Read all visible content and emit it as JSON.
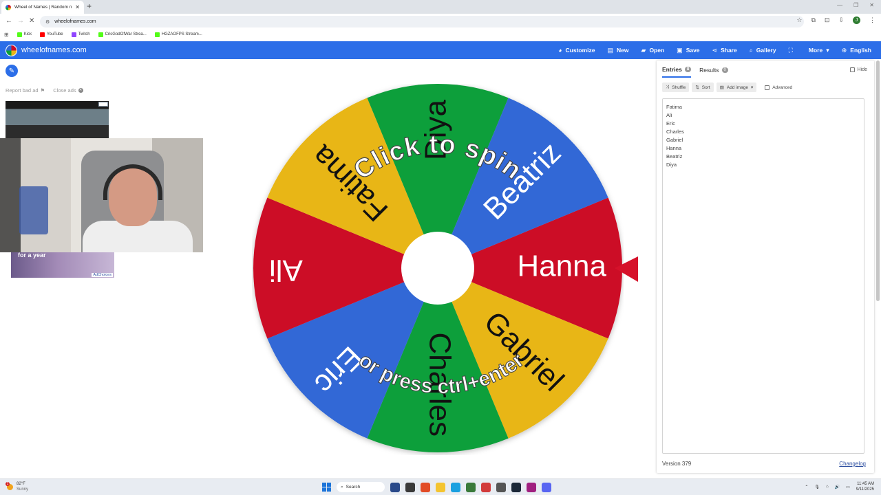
{
  "browser": {
    "tab_title": "Wheel of Names | Random nam",
    "tab_close": "✕",
    "new_tab": "+",
    "url": "wheelofnames.com",
    "bookmarks": [
      {
        "label": "Kick",
        "color": "#53fc18"
      },
      {
        "label": "YouTube",
        "color": "#ff0000"
      },
      {
        "label": "Twitch",
        "color": "#9146ff"
      },
      {
        "label": "CrisGodOfWar Strea...",
        "color": "#53fc18"
      },
      {
        "label": "HGZAOFPS Stream...",
        "color": "#53fc18"
      }
    ],
    "profile_initial": "J"
  },
  "app": {
    "brand": "wheelofnames.com",
    "menu": [
      {
        "label": "Customize",
        "icon": "palette-icon",
        "glyph": "◕"
      },
      {
        "label": "New",
        "icon": "new-file-icon",
        "glyph": "▤"
      },
      {
        "label": "Open",
        "icon": "folder-icon",
        "glyph": "▰"
      },
      {
        "label": "Save",
        "icon": "save-icon",
        "glyph": "▣"
      },
      {
        "label": "Share",
        "icon": "share-icon",
        "glyph": "⋖"
      },
      {
        "label": "Gallery",
        "icon": "search-icon",
        "glyph": "⌕"
      },
      {
        "label": "",
        "icon": "fullscreen-icon",
        "glyph": "⛶"
      },
      {
        "label": "More",
        "icon": "chevron-down-icon",
        "glyph": "▾"
      },
      {
        "label": "English",
        "icon": "globe-icon",
        "glyph": "⊕"
      }
    ],
    "accent": "#2c6ee8"
  },
  "ads": {
    "report_bad_ad": "Report bad ad",
    "close_ads": "Close ads",
    "ad_choices": "AdChoices",
    "ad_caption": "for a year"
  },
  "wheel": {
    "colors": [
      "#cc0c28",
      "#e8b619",
      "#0c9f3a",
      "#3368d6"
    ],
    "segments": [
      "Hanna",
      "Gabriel",
      "Charles",
      "Eric",
      "Ali",
      "Fatima",
      "Diya",
      "Beatriz"
    ],
    "click_to_spin": "Click to spin",
    "or_press": "or press ctrl+enter",
    "pointer_color": "#d6112a"
  },
  "panel": {
    "tab_entries": "Entries",
    "entries_count": "8",
    "tab_results": "Results",
    "results_count": "0",
    "hide_label": "Hide",
    "shuffle": "Shuffle",
    "sort": "Sort",
    "add_image": "Add image",
    "advanced": "Advanced",
    "entries": [
      "Fatima",
      "Ali",
      "Eric",
      "Charles",
      "Gabriel",
      "Hanna",
      "Beatriz",
      "Diya"
    ],
    "version": "Version 379",
    "changelog": "Changelog"
  },
  "taskbar": {
    "temperature": "82°F",
    "condition": "Sunny",
    "search": "Search",
    "time": "11:45 AM",
    "date": "9/11/2025",
    "apps": [
      "#2a4a8a",
      "#3a3a3a",
      "#e24c26",
      "#f4c430",
      "#1aa0e0",
      "#3a7a3a",
      "#d23b3b",
      "#555555",
      "#1b2838",
      "#a02080",
      "#5865f2"
    ]
  }
}
